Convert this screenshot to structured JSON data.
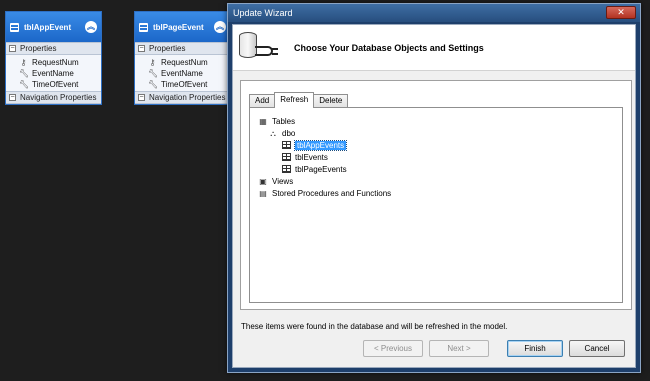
{
  "entities": [
    {
      "title": "tblAppEvent",
      "properties_header": "Properties",
      "properties": [
        "RequestNum",
        "EventName",
        "TimeOfEvent"
      ],
      "nav_header": "Navigation Properties"
    },
    {
      "title": "tblPageEvent",
      "properties_header": "Properties",
      "properties": [
        "RequestNum",
        "EventName",
        "TimeOfEvent"
      ],
      "nav_header": "Navigation Properties"
    }
  ],
  "wizard": {
    "window_title": "Update Wizard",
    "close_glyph": "✕",
    "header_title": "Choose Your Database Objects and Settings",
    "tabs": [
      "Add",
      "Refresh",
      "Delete"
    ],
    "active_tab": "Refresh",
    "tree": {
      "tables": "Tables",
      "schema": "dbo",
      "table_items": [
        "tblAppEvents",
        "tblEvents",
        "tblPageEvents"
      ],
      "selected_item": "tblAppEvents",
      "views": "Views",
      "procedures": "Stored Procedures and Functions"
    },
    "info_text": "These items were found in the database and will be refreshed in the model.",
    "buttons": {
      "previous": "< Previous",
      "next": "Next >",
      "finish": "Finish",
      "cancel": "Cancel"
    }
  },
  "colors": {
    "canvas": "#1e1e1e",
    "entity_header": "#1c67c9",
    "selection": "#3399ff"
  }
}
